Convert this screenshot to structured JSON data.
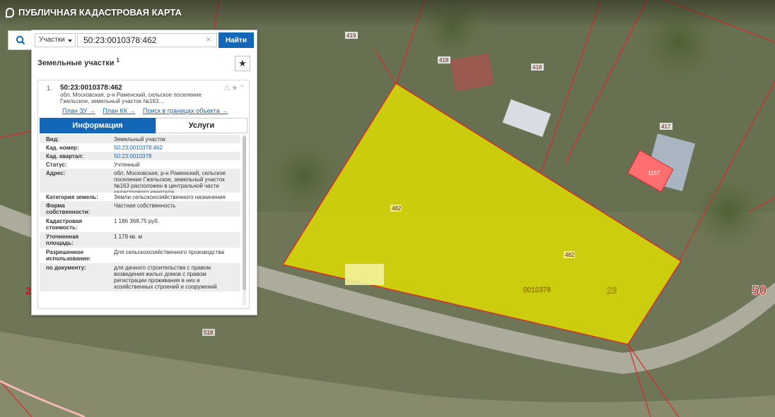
{
  "app": {
    "title": "ПУБЛИЧНАЯ КАДАСТРОВАЯ КАРТА"
  },
  "search": {
    "type_label": "Участки",
    "value": "50:23:0010378:462",
    "clear_label": "×",
    "submit_label": "Найти"
  },
  "results": {
    "title": "Земельные участки",
    "count": "1"
  },
  "card": {
    "index": "1.",
    "cadastral_id": "50:23:0010378:462",
    "address_preview": "обл. Московская, р-н Раменский, сельское поселение Гжельское, земельный участок №163…",
    "links": [
      "План ЗУ →",
      "План КК →",
      "Поиск в границах объекта →"
    ]
  },
  "tabs": {
    "info": "Информация",
    "services": "Услуги"
  },
  "info_rows": [
    {
      "key": "Вид:",
      "value": "Земельный участок",
      "link": false
    },
    {
      "key": "Кад. номер:",
      "value": "50:23:0010378:462",
      "link": true
    },
    {
      "key": "Кад. квартал:",
      "value": "50:23:0010378",
      "link": true
    },
    {
      "key": "Статус:",
      "value": "Учтенный",
      "link": false
    },
    {
      "key": "Адрес:",
      "value": "обл. Московская, р-н Раменский, сельское поселение Гжельское, земельный участок №163 расположен в центральной части кадастрового квартала",
      "link": false
    },
    {
      "key": "Категория земель:",
      "value": "Земли сельскохозяйственного назначения",
      "link": false
    },
    {
      "key": "Форма собственности:",
      "value": "Частная собственность",
      "link": false
    },
    {
      "key": "Кадастровая стоимость:",
      "value": "1 186 368,75 руб.",
      "link": false
    },
    {
      "key": "Уточненная площадь:",
      "value": "1 179 кв. м",
      "link": false
    },
    {
      "key": "Разрешенное использование:",
      "value": "Для сельскохозяйственного производства",
      "link": false
    },
    {
      "key": "по документу:",
      "value": "для дачного строительства с правом возведения жилых домов с правом регистрации проживания в них и хозяйственных строений и сооружений",
      "link": false
    }
  ],
  "map_labels": {
    "parcel_419": "419",
    "parcel_418a": "418",
    "parcel_418b": "418",
    "parcel_417": "417",
    "parcel_1197": "1197",
    "parcel_462a": "462",
    "parcel_462b": "462",
    "quarter_number": "0010378",
    "district_number": "23",
    "region_number": "50",
    "parcel_518": "518",
    "edge_label": "2"
  },
  "colors": {
    "accent": "#1367b6",
    "parcel_fill": "#e2e000",
    "boundary": "#d82a2a"
  }
}
